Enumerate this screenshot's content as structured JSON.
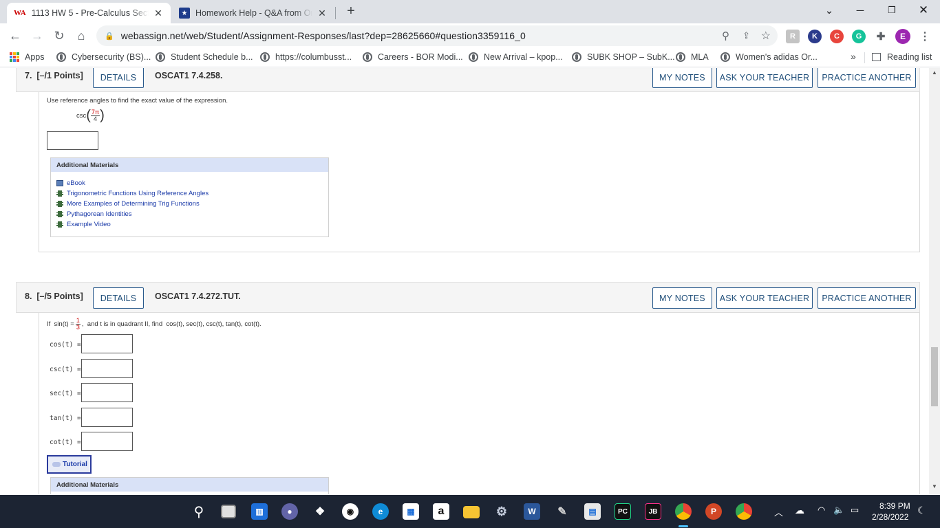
{
  "browser": {
    "tabs": [
      {
        "title": "1113 HW 5 - Pre-Calculus Sectio",
        "favicon": "webassign-icon",
        "active": true
      },
      {
        "title": "Homework Help - Q&A from Onl",
        "favicon": "star-shield-icon",
        "active": false
      }
    ],
    "new_tab": "+",
    "url": "webassign.net/web/Student/Assignment-Responses/last?dep=28625660#question3359116_0",
    "profile_initial": "E",
    "bookmarks": [
      {
        "label": "Apps"
      },
      {
        "label": "Cybersecurity (BS)..."
      },
      {
        "label": "Student Schedule b..."
      },
      {
        "label": "https://columbusst..."
      },
      {
        "label": "Careers - BOR Modi..."
      },
      {
        "label": "New Arrival – kpop..."
      },
      {
        "label": "SUBK SHOP – SubK..."
      },
      {
        "label": "MLA"
      },
      {
        "label": "Women's adidas Or..."
      }
    ],
    "bookmarks_overflow": "»",
    "reading_list": "Reading list"
  },
  "q7": {
    "number": "7.",
    "points": "[–/1 Points]",
    "details": "DETAILS",
    "code": "OSCAT1 7.4.258.",
    "my_notes": "MY NOTES",
    "ask_teacher": "ASK YOUR TEACHER",
    "practice": "PRACTICE ANOTHER",
    "prompt": "Use reference angles to find the exact value of the expression.",
    "expr_fn": "csc",
    "expr_num": "7π",
    "expr_den": "4",
    "materials_title": "Additional Materials",
    "materials": [
      {
        "label": "eBook",
        "icon": "book-icon"
      },
      {
        "label": "Trigonometric Functions Using Reference Angles",
        "icon": "video-icon"
      },
      {
        "label": "More Examples of Determining Trig Functions",
        "icon": "video-icon"
      },
      {
        "label": "Pythagorean Identities",
        "icon": "video-icon"
      },
      {
        "label": "Example Video",
        "icon": "video-icon"
      }
    ]
  },
  "q8": {
    "number": "8.",
    "points": "[–/5 Points]",
    "details": "DETAILS",
    "code": "OSCAT1 7.4.272.TUT.",
    "my_notes": "MY NOTES",
    "ask_teacher": "ASK YOUR TEACHER",
    "practice": "PRACTICE ANOTHER",
    "prompt_pre": "If  sin(t) =",
    "prompt_num": "1",
    "prompt_den": "3",
    "prompt_post": ",  and t is in quadrant II, find  cos(t), sec(t), csc(t), tan(t), cot(t).",
    "fields": [
      {
        "label": "cos(t)  ="
      },
      {
        "label": "csc(t)  ="
      },
      {
        "label": "sec(t)  ="
      },
      {
        "label": "tan(t)  ="
      },
      {
        "label": "cot(t)  ="
      }
    ],
    "tutorial": "Tutorial",
    "materials_title": "Additional Materials"
  },
  "taskbar": {
    "time": "8:39 PM",
    "date": "2/28/2022"
  },
  "colors": {
    "link": "#1a3aa8",
    "button_border": "#2a5a8c",
    "taskbar": "#1c2433",
    "materials_header": "#d9e2f7"
  }
}
